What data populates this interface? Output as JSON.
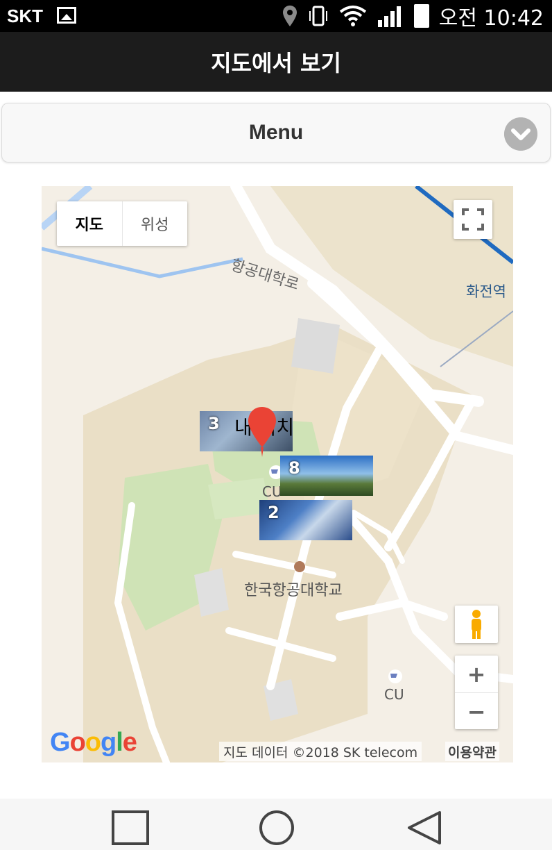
{
  "status_bar": {
    "carrier": "SKT",
    "time": "오전 10:42",
    "icons": [
      "image-icon",
      "location-pin-icon",
      "vibrate-icon",
      "wifi-icon",
      "signal-icon",
      "battery-icon"
    ]
  },
  "title_bar": {
    "title": "지도에서 보기"
  },
  "menu": {
    "label": "Menu",
    "icon": "chevron-down-circle-icon"
  },
  "map": {
    "type_toggle": {
      "map_label": "지도",
      "satellite_label": "위성",
      "selected": "지도"
    },
    "labels": {
      "road": "항공대학로",
      "station": "화전역",
      "university": "한국항공대학교",
      "store_1": "CU",
      "store_2": "CU"
    },
    "my_location": "내 위치",
    "photo_markers": [
      {
        "number": "3"
      },
      {
        "number": "8"
      },
      {
        "number": "2"
      }
    ],
    "zoom_in": "+",
    "zoom_out": "−",
    "google_logo": "Google",
    "attribution": "지도 데이터 ©2018 SK telecom",
    "terms": "이용약관"
  },
  "colors": {
    "title_bar_bg": "#1c1c1c",
    "marker_red": "#ea4335",
    "map_bg": "#f4efe6"
  },
  "nav_bar": {
    "buttons": [
      "recent-apps-icon",
      "home-icon",
      "back-icon"
    ]
  }
}
